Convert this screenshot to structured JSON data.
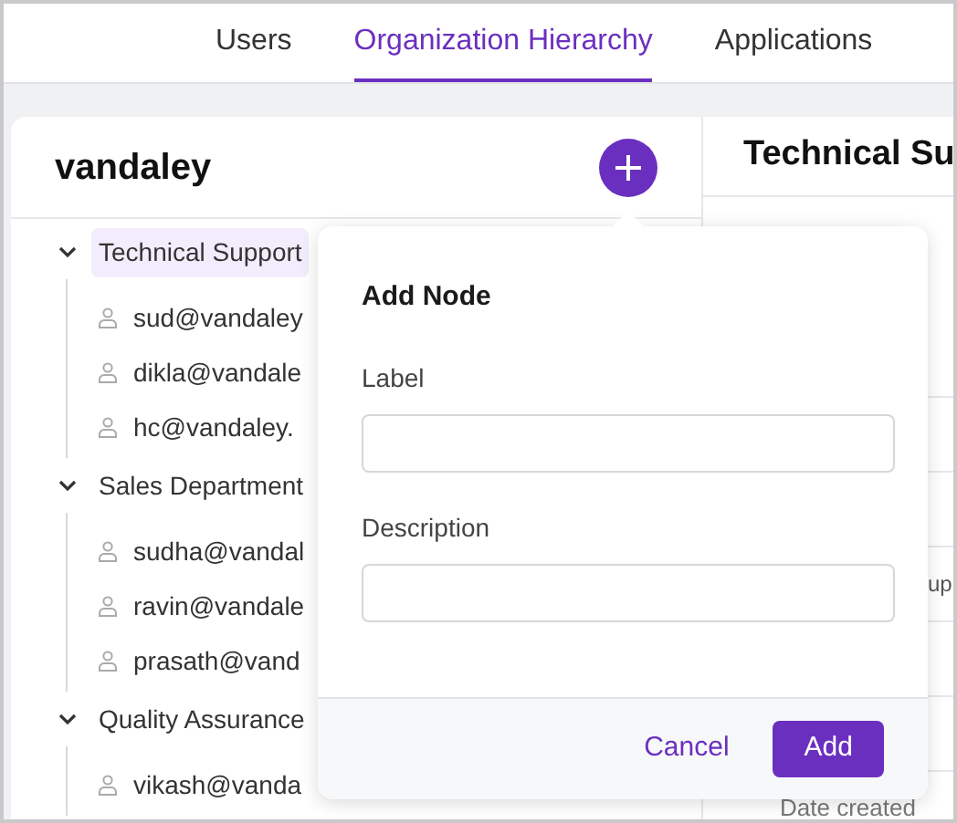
{
  "tabs": [
    {
      "label": "Users",
      "selected": false
    },
    {
      "label": "Organization Hierarchy",
      "selected": true
    },
    {
      "label": "Applications",
      "selected": false
    }
  ],
  "tree": {
    "title": "vandaley",
    "groups": [
      {
        "label": "Technical Support",
        "expanded": true,
        "selected": true,
        "children": [
          {
            "label": "sud@vandaley"
          },
          {
            "label": "dikla@vandale"
          },
          {
            "label": "hc@vandaley."
          }
        ]
      },
      {
        "label": "Sales Department",
        "expanded": true,
        "selected": false,
        "children": [
          {
            "label": "sudha@vandal"
          },
          {
            "label": "ravin@vandale"
          },
          {
            "label": "prasath@vand"
          }
        ]
      },
      {
        "label": "Quality Assurance",
        "expanded": true,
        "selected": false,
        "children": [
          {
            "label": "vikash@vanda"
          }
        ]
      }
    ]
  },
  "details": {
    "title": "Technical Su",
    "side_text": "up",
    "footer_label": "Date created"
  },
  "dialog": {
    "title": "Add Node",
    "fields": [
      {
        "label": "Label"
      },
      {
        "label": "Description"
      }
    ],
    "buttons": [
      {
        "label": "Cancel",
        "kind": "secondary"
      },
      {
        "label": "Add",
        "kind": "primary"
      }
    ]
  }
}
